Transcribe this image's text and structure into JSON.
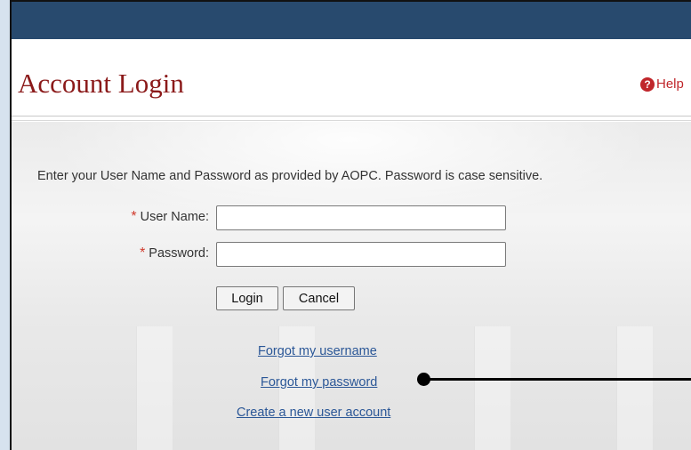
{
  "header": {
    "title": "Account Login",
    "help_label": "Help"
  },
  "form": {
    "instructions": "Enter your User Name and Password as provided by AOPC. Password is case sensitive.",
    "required_marker": "*",
    "username_label": "User Name:",
    "username_value": "",
    "password_label": "Password:",
    "password_value": "",
    "login_label": "Login",
    "cancel_label": "Cancel"
  },
  "links": {
    "forgot_username": "Forgot my username",
    "forgot_password": "Forgot my password",
    "create_account": "Create a new user account"
  },
  "colors": {
    "topbar": "#284a6e",
    "title": "#8b1a1a",
    "link": "#2b5797",
    "required": "#d0392b"
  },
  "icons": {
    "help": "question-circle-icon"
  }
}
